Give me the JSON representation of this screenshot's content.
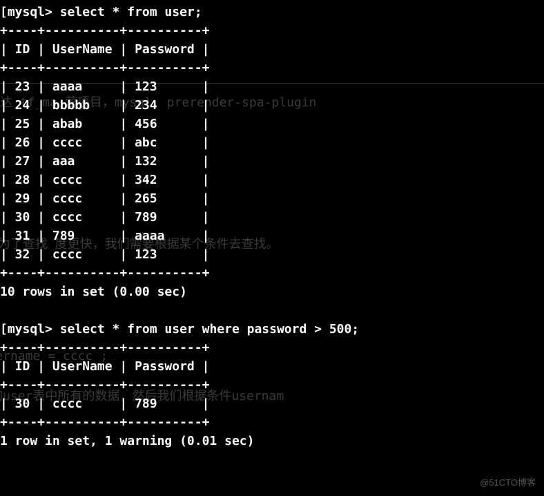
{
  "terminal": {
    "prompt": "[mysql>",
    "query1": "select * from user;",
    "query2": "select * from user where password > 500;",
    "header_sep": "+----+----------+----------+",
    "header_row": "| ID | UserName | Password |",
    "result1": {
      "columns": [
        "ID",
        "UserName",
        "Password"
      ],
      "rows": [
        {
          "id": "23",
          "username": "aaaa",
          "password": "123"
        },
        {
          "id": "24",
          "username": "bbbbb",
          "password": "234"
        },
        {
          "id": "25",
          "username": "abab",
          "password": "456"
        },
        {
          "id": "26",
          "username": "cccc",
          "password": "abc"
        },
        {
          "id": "27",
          "username": "aaa",
          "password": "132"
        },
        {
          "id": "28",
          "username": "cccc",
          "password": "342"
        },
        {
          "id": "29",
          "username": "cccc",
          "password": "265"
        },
        {
          "id": "30",
          "username": "cccc",
          "password": "789"
        },
        {
          "id": "31",
          "username": "789",
          "password": "aaaa"
        },
        {
          "id": "32",
          "username": "cccc",
          "password": "123"
        }
      ],
      "footer": "10 rows in set (0.00 sec)"
    },
    "result2": {
      "columns": [
        "ID",
        "UserName",
        "Password"
      ],
      "rows": [
        {
          "id": "30",
          "username": "cccc",
          "password": "789"
        }
      ],
      "footer": "1 row in set, 1 warning (0.01 sec)"
    }
  },
  "ghost_text": {
    "g1": "达    tf_ma    营项目，mysql, prerender-spa-plugin",
    "g2": "的，    为了查找    度更快，我们需要根据某个条件去查找。",
    "g3": "e username =  cccc ;",
    "g4": "会查询user表中所有的数据，然后我们根据条件usernam"
  },
  "watermark": "@51CTO博客"
}
